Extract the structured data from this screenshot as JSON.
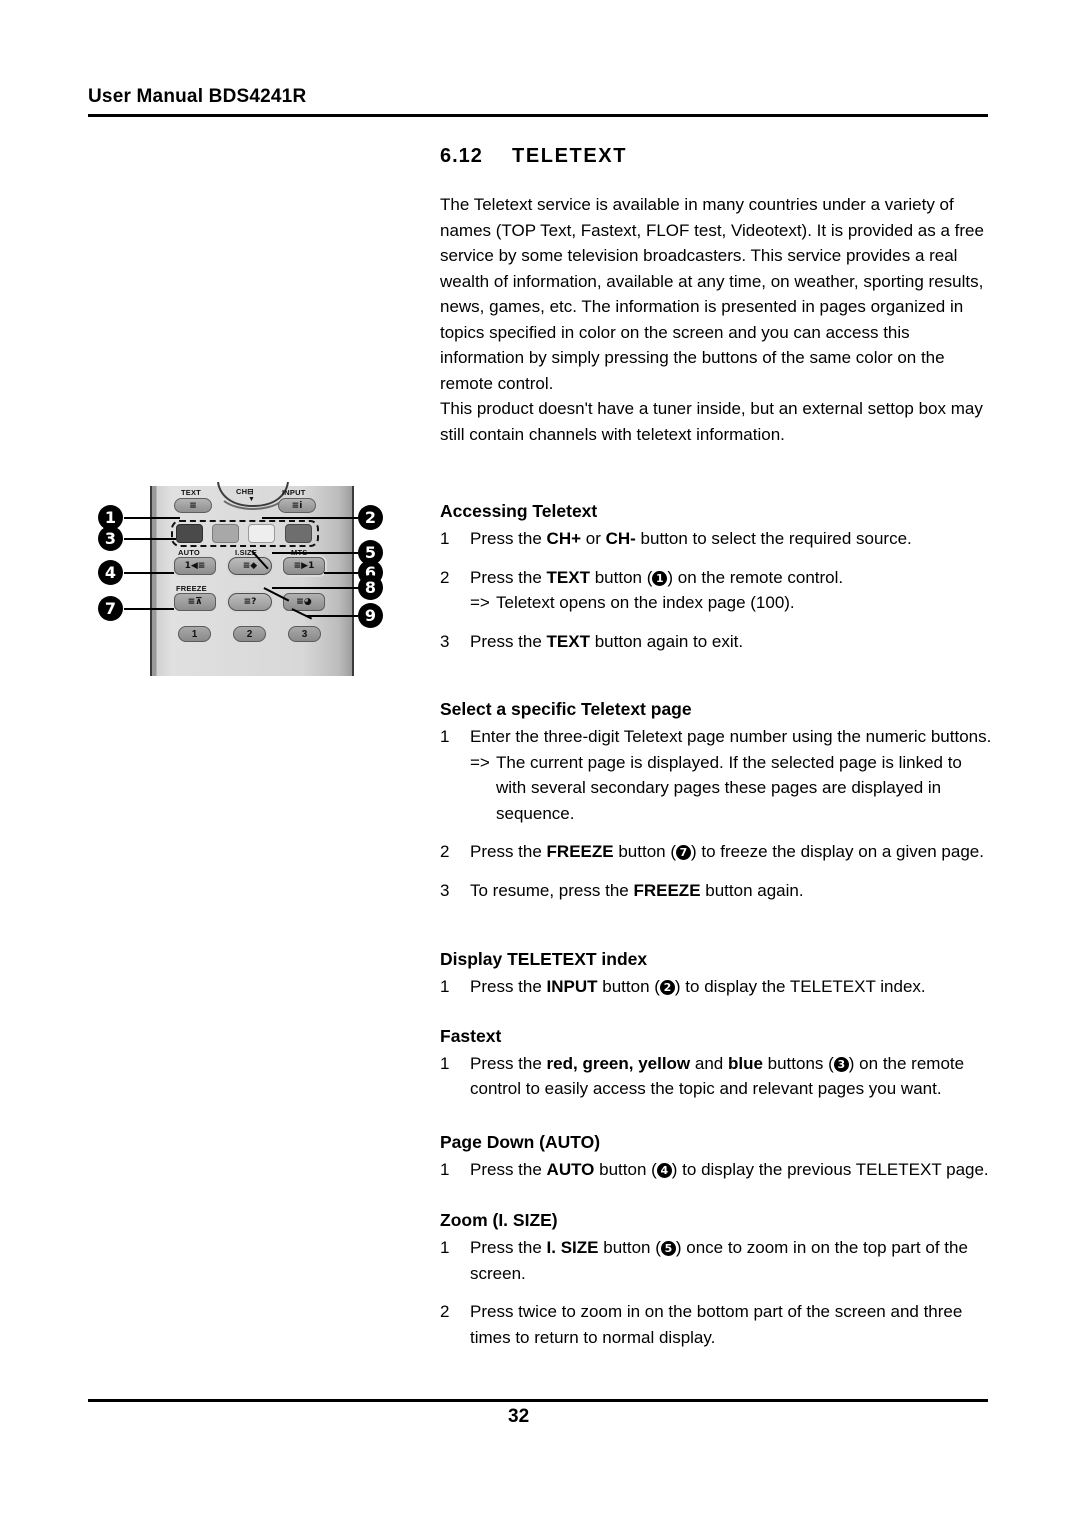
{
  "header": {
    "title": "User Manual BDS4241R"
  },
  "section": {
    "number": "6.12",
    "title": "TELETEXT"
  },
  "intro": {
    "paragraph1": "The Teletext service is available in many countries under a variety of names (TOP Text, Fastext, FLOF test, Videotext). It is provided as a free service by some television broadcasters. This service provides a real wealth of information, available at any time, on weather, sporting results, news, games, etc. The information is presented in pages organized in topics specified in color on the screen and you can access this information by simply pressing the buttons of the same color on the remote control.",
    "paragraph2": "This product doesn't have a tuner inside, but an external settop box may still contain channels with teletext information."
  },
  "sections": {
    "accessing": {
      "heading": "Accessing Teletext",
      "step1_n": "1",
      "step1_a": "Press the ",
      "step1_b1": "CH+",
      "step1_mid": " or ",
      "step1_b2": "CH-",
      "step1_c": " button to select the required source.",
      "step2_n": "2",
      "step2_a": "Press the ",
      "step2_b": "TEXT",
      "step2_c": " button (",
      "step2_badge": "1",
      "step2_d": ") on the remote control.",
      "step2_arrow_mark": "=>",
      "step2_arrow_body": "Teletext opens on the index page (100).",
      "step3_n": "3",
      "step3_a": "Press the ",
      "step3_b": "TEXT",
      "step3_c": " button again to exit."
    },
    "select_page": {
      "heading": "Select a specific Teletext page",
      "step1_n": "1",
      "step1_a": "Enter the three-digit Teletext page number using the numeric buttons.",
      "step1_arrow_mark": "=>",
      "step1_arrow_body": "The current page is displayed. If the selected page is linked to with several secondary pages these pages are displayed in sequence.",
      "step2_n": "2",
      "step2_a": "Press the ",
      "step2_b": "FREEZE",
      "step2_c": " button (",
      "step2_badge": "7",
      "step2_d": ") to freeze the display on a given page.",
      "step3_n": "3",
      "step3_a": "To resume, press the ",
      "step3_b": "FREEZE",
      "step3_c": " button again."
    },
    "display_index": {
      "heading": "Display TELETEXT index",
      "step1_n": "1",
      "step1_a": "Press the ",
      "step1_b": "INPUT",
      "step1_c": " button (",
      "step1_badge": "2",
      "step1_d": ") to display the TELETEXT index."
    },
    "fastext": {
      "heading": "Fastext",
      "step1_n": "1",
      "step1_a": "Press the ",
      "step1_b1": "red, green, yellow",
      "step1_mid": " and ",
      "step1_b2": "blue",
      "step1_c": " buttons (",
      "step1_badge": "3",
      "step1_d": ") on the remote control to easily access the topic and relevant pages you want."
    },
    "page_down": {
      "heading": "Page Down (AUTO)",
      "step1_n": "1",
      "step1_a": "Press the ",
      "step1_b": "AUTO",
      "step1_c": " button (",
      "step1_badge": "4",
      "step1_d": ") to display the previous TELETEXT page."
    },
    "zoom": {
      "heading": "Zoom (I. SIZE)",
      "step1_n": "1",
      "step1_a": "Press the ",
      "step1_b": "I. SIZE",
      "step1_c": " button (",
      "step1_badge": "5",
      "step1_d": ") once to zoom in on the top part of the screen.",
      "step2_n": "2",
      "step2_a": "Press twice to zoom in on the bottom part of the screen and three times to return to normal display."
    }
  },
  "figure": {
    "callouts": {
      "c1": "1",
      "c2": "2",
      "c3": "3",
      "c4": "4",
      "c5": "5",
      "c6": "6",
      "c7": "7",
      "c8": "8",
      "c9": "9"
    },
    "labels": {
      "text": "TEXT",
      "ch": "CH",
      "input": "INPUT",
      "auto": "AUTO",
      "isize": "I.SIZE",
      "mts": "MTS",
      "freeze": "FREEZE"
    },
    "glyphs": {
      "text_btn": "≡",
      "input_btn": "≡i",
      "auto_btn": "1◀≡",
      "isize_btn": "≡◆",
      "mts_btn": "≡▶1",
      "freeze_btn": "≡⊼",
      "reveal_btn": "≡?",
      "subpage_btn": "≡◕",
      "ch_minus": "⊟",
      "ch_down_arrow": "▼"
    },
    "numeric": {
      "n1": "1",
      "n2": "2",
      "n3": "3"
    },
    "colors": {
      "color_btn_1": "#4a4a4a",
      "color_btn_2": "#a8a8a8",
      "color_btn_3": "#eeeeee",
      "color_btn_4": "#6e6e6e"
    }
  },
  "footer": {
    "page_number": "32"
  }
}
